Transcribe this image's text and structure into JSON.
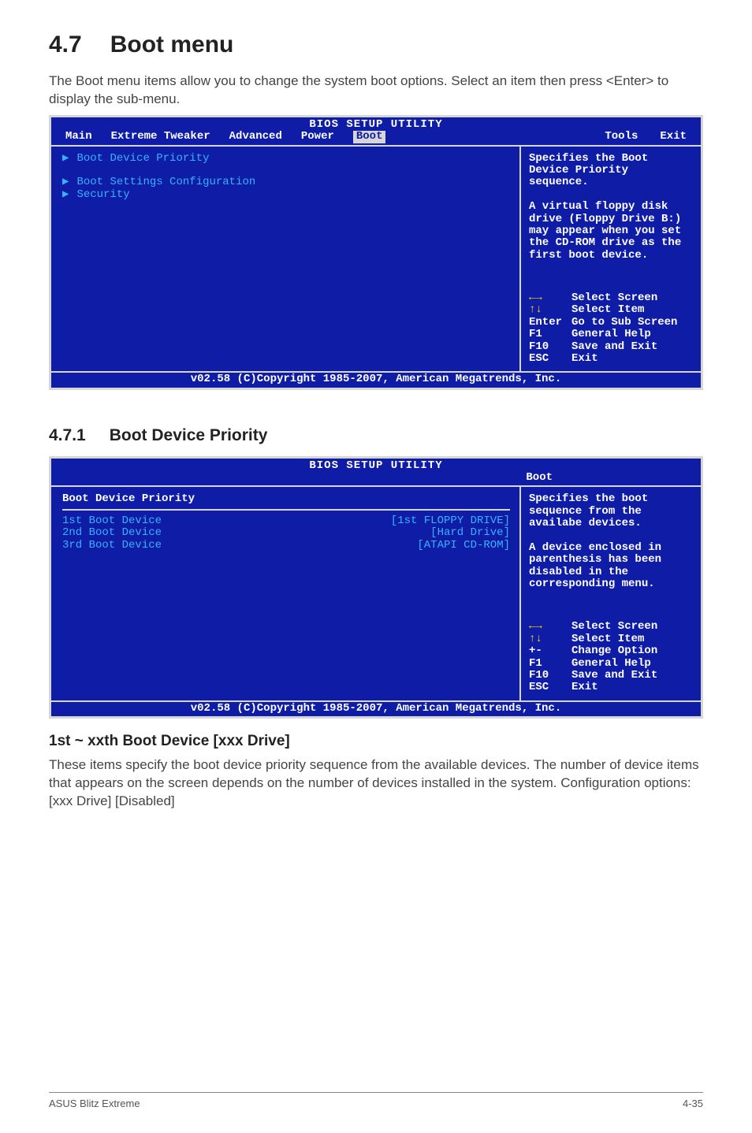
{
  "section": {
    "number": "4.7",
    "title": "Boot menu",
    "intro": "The Boot menu items allow you to change the system boot options. Select an item then press <Enter> to display the sub-menu."
  },
  "bios1": {
    "title": "BIOS SETUP UTILITY",
    "tabs": {
      "main": "Main",
      "extreme": "Extreme Tweaker",
      "advanced": "Advanced",
      "power": "Power",
      "boot": "Boot",
      "tools": "Tools",
      "exit": "Exit"
    },
    "left": {
      "items": [
        "Boot Device Priority",
        "Boot Settings Configuration",
        "Security"
      ]
    },
    "right": {
      "help1": "Specifies the Boot Device Priority sequence.",
      "help2": "A virtual floppy disk drive (Floppy Drive B:) may appear when you set the CD-ROM drive as the first boot device.",
      "nav": {
        "selectScreen": "Select Screen",
        "selectItem": "Select Item",
        "enterKey": "Enter",
        "enterLabel": "Go to Sub Screen",
        "f1Key": "F1",
        "f1Label": "General Help",
        "f10Key": "F10",
        "f10Label": "Save and Exit",
        "escKey": "ESC",
        "escLabel": "Exit"
      }
    },
    "footer": "v02.58 (C)Copyright 1985-2007, American Megatrends, Inc."
  },
  "subsection": {
    "number": "4.7.1",
    "title": "Boot Device Priority"
  },
  "bios2": {
    "title": "BIOS SETUP UTILITY",
    "tab": "Boot",
    "left": {
      "header": "Boot Device Priority",
      "rows": [
        {
          "label": "1st Boot Device",
          "value": "[1st FLOPPY DRIVE]"
        },
        {
          "label": "2nd Boot Device",
          "value": "[Hard Drive]"
        },
        {
          "label": "3rd Boot Device",
          "value": "[ATAPI CD-ROM]"
        }
      ]
    },
    "right": {
      "help1": "Specifies the boot sequence from the availabe devices.",
      "help2": "A device enclosed in parenthesis has been disabled in the corresponding menu.",
      "nav": {
        "selectScreen": "Select Screen",
        "selectItem": "Select Item",
        "pmKey": "+-",
        "pmLabel": "Change Option",
        "f1Key": "F1",
        "f1Label": "General Help",
        "f10Key": "F10",
        "f10Label": "Save and Exit",
        "escKey": "ESC",
        "escLabel": "Exit"
      }
    },
    "footer": "v02.58 (C)Copyright 1985-2007, American Megatrends, Inc."
  },
  "sub_heading": "1st ~ xxth Boot Device [xxx Drive]",
  "sub_body": "These items specify the boot device priority sequence from the available devices. The number of device items that appears on the screen depends on the number of devices installed in the system. Configuration options: [xxx Drive] [Disabled]",
  "footer": {
    "left": "ASUS Blitz Extreme",
    "right": "4-35"
  }
}
